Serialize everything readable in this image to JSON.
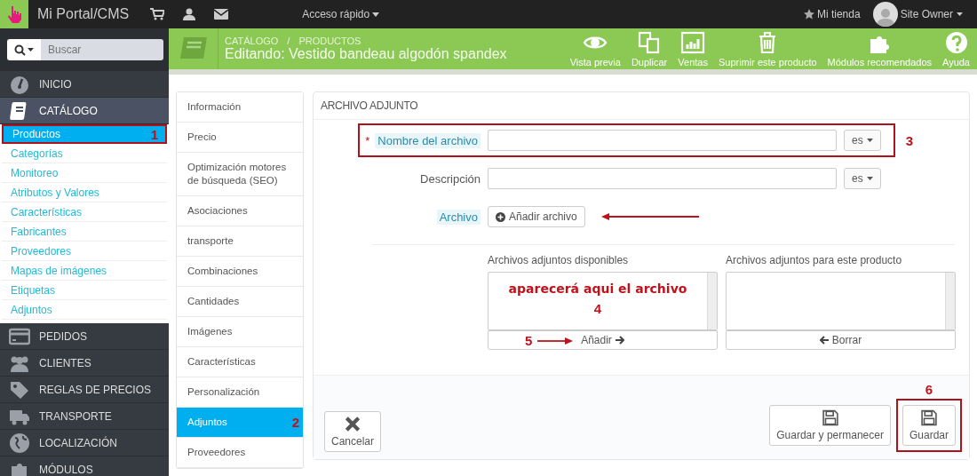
{
  "topbar": {
    "brand": "Mi Portal/CMS",
    "quick_access": "Acceso rápido",
    "shop": "Mi tienda",
    "user": "Site Owner"
  },
  "search": {
    "placeholder": "Buscar"
  },
  "sidebar": {
    "items": [
      {
        "label": "INICIO",
        "selected": false
      },
      {
        "label": "CATÁLOGO",
        "selected": true,
        "children": [
          {
            "label": "Productos",
            "selected": true,
            "annotation": "1"
          },
          {
            "label": "Categorías",
            "selected": false
          },
          {
            "label": "Monitoreo",
            "selected": false
          },
          {
            "label": "Atributos y Valores",
            "selected": false
          },
          {
            "label": "Características",
            "selected": false
          },
          {
            "label": "Fabricantes",
            "selected": false
          },
          {
            "label": "Proveedores",
            "selected": false
          },
          {
            "label": "Mapas de imágenes",
            "selected": false
          },
          {
            "label": "Etiquetas",
            "selected": false
          },
          {
            "label": "Adjuntos",
            "selected": false
          }
        ]
      },
      {
        "label": "PEDIDOS",
        "selected": false
      },
      {
        "label": "CLIENTES",
        "selected": false
      },
      {
        "label": "REGLAS DE PRECIOS",
        "selected": false
      },
      {
        "label": "TRANSPORTE",
        "selected": false
      },
      {
        "label": "LOCALIZACIÓN",
        "selected": false
      },
      {
        "label": "MÓDULOS",
        "selected": false
      }
    ]
  },
  "header": {
    "breadcrumb": [
      "CATÁLOGO",
      "PRODUCTOS"
    ],
    "breadcrumb_separator": "/",
    "title": "Editando: Vestido bandeau algodón spandex",
    "actions": [
      "Vista previa",
      "Duplicar",
      "Ventas",
      "Suprimir este producto",
      "Módulos recomendados",
      "Ayuda"
    ]
  },
  "tabs": [
    {
      "label": "Información",
      "selected": false
    },
    {
      "label": "Precio",
      "selected": false
    },
    {
      "label": "Optimización motores de búsqueda (SEO)",
      "selected": false
    },
    {
      "label": "Asociaciones",
      "selected": false
    },
    {
      "label": "transporte",
      "selected": false
    },
    {
      "label": "Combinaciones",
      "selected": false
    },
    {
      "label": "Cantidades",
      "selected": false
    },
    {
      "label": "Imágenes",
      "selected": false
    },
    {
      "label": "Características",
      "selected": false
    },
    {
      "label": "Personalización",
      "selected": false
    },
    {
      "label": "Adjuntos",
      "selected": true,
      "annotation": "2"
    },
    {
      "label": "Proveedores",
      "selected": false
    }
  ],
  "panel": {
    "title": "ARCHIVO ADJUNTO",
    "fields": [
      {
        "kind": "text",
        "label": "Nombre del archivo",
        "required_mark": "*",
        "hint": true,
        "lang": "es",
        "annotation": "3"
      },
      {
        "kind": "text",
        "label": "Descripción",
        "hint": false,
        "lang": "es"
      },
      {
        "kind": "file",
        "label": "Archivo",
        "hint": true,
        "button": "Añadir archivo",
        "arrow": true
      }
    ],
    "lists": [
      {
        "title": "Archivos adjuntos disponibles",
        "note": "aparecerá aqui el archivo",
        "annotation": "4",
        "button": "Añadir",
        "button_annotation": "5",
        "kind": "add"
      },
      {
        "title": "Archivos adjuntos para este producto",
        "button": "Borrar",
        "kind": "remove"
      }
    ],
    "cancel": "Cancelar",
    "save_buttons": [
      {
        "label": "Guardar y permanecer"
      },
      {
        "label": "Guardar",
        "annotation": "6"
      }
    ]
  }
}
